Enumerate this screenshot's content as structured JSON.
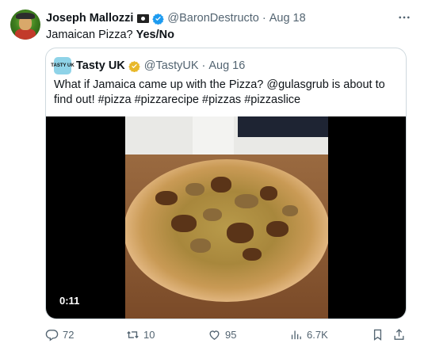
{
  "tweet": {
    "author_name": "Joseph Mallozzi",
    "author_handle": "@BaronDestructo",
    "separator": "·",
    "time": "Aug 18",
    "text": "Jamaican Pizza?",
    "text_bold": "Yes/No"
  },
  "quote": {
    "avatar_text": "TASTY UK",
    "author_name": "Tasty UK",
    "author_handle": "@TastyUK",
    "separator": "·",
    "time": "Aug 16",
    "text": "What if Jamaica came up with the Pizza? @gulasgrub is about to find out! #pizza #pizzarecipe #pizzas #pizzaslice",
    "video_duration": "0:11"
  },
  "actions": {
    "replies": "72",
    "retweets": "10",
    "likes": "95",
    "views": "6.7K"
  },
  "colors": {
    "verified_blue": "#1d9bf0",
    "verified_gold": "#e8b829",
    "secondary_text": "#536471"
  }
}
